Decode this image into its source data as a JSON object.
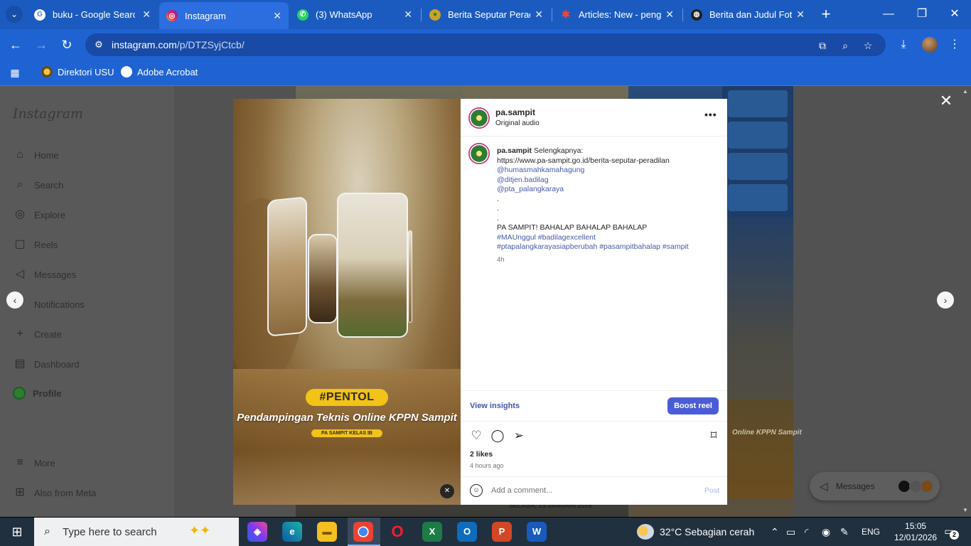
{
  "browser": {
    "tabs": [
      {
        "title": "buku - Google Search",
        "favicon": "google-icon",
        "active": false
      },
      {
        "title": "Instagram",
        "favicon": "instagram-icon",
        "active": true
      },
      {
        "title": "(3) WhatsApp",
        "favicon": "whatsapp-icon",
        "active": false
      },
      {
        "title": "Berita Seputar Peradilan",
        "favicon": "pa-logo-icon",
        "active": false
      },
      {
        "title": "Articles: New - pengadilan",
        "favicon": "joomla-icon",
        "active": false
      },
      {
        "title": "Berita dan Judul Foto",
        "favicon": "web-icon",
        "active": false
      }
    ],
    "url_host": "instagram.com",
    "url_path": "/p/DTZSyjCtcb/",
    "bookmarks": [
      {
        "label": "Direktori USU"
      },
      {
        "label": "Adobe Acrobat"
      }
    ]
  },
  "sidebar": {
    "logo": "Instagram",
    "items": [
      {
        "label": "Home",
        "icon": "home-icon"
      },
      {
        "label": "Search",
        "icon": "search-icon"
      },
      {
        "label": "Explore",
        "icon": "compass-icon"
      },
      {
        "label": "Reels",
        "icon": "reels-icon"
      },
      {
        "label": "Messages",
        "icon": "messenger-icon"
      },
      {
        "label": "Notifications",
        "icon": "heart-icon"
      },
      {
        "label": "Create",
        "icon": "plus-icon"
      },
      {
        "label": "Dashboard",
        "icon": "dashboard-icon"
      },
      {
        "label": "Profile",
        "icon": "avatar"
      },
      {
        "label": "More",
        "icon": "menu-icon"
      },
      {
        "label": "Also from Meta",
        "icon": "meta-icon"
      }
    ]
  },
  "background": {
    "right_caption": "Online KPPN Sampit",
    "bottom_caption": "SELASA, 13 JANUARI 2026"
  },
  "post": {
    "username": "pa.sampit",
    "audio": "Original audio",
    "media": {
      "badge": "#PENTOL",
      "subtitle": "Pendampingan Teknis Online KPPN Sampit",
      "tag": "PA SAMPIT KELAS IB"
    },
    "caption": {
      "user": "pa.sampit",
      "lines": [
        "Selengkapnya:",
        "https://www.pa-sampit.go.id/berita-seputar-peradilan",
        "@humasmahkamahagung",
        "@ditjen.badilag",
        "@pta_palangkaraya",
        ".",
        ".",
        ".",
        "PA SAMPIT! BAHALAP BAHALAP BAHALAP",
        "#MAUnggul #badilagexcellent",
        "#ptapalangkarayasiapberubah #pasampitbahalap #sampit"
      ],
      "time": "4h"
    },
    "view_insights": "View insights",
    "boost_label": "Boost reel",
    "likes": "2 likes",
    "ago": "4 hours ago",
    "comment_placeholder": "Add a comment...",
    "post_label": "Post"
  },
  "messages_pill": {
    "label": "Messages"
  },
  "taskbar": {
    "search_placeholder": "Type here to search",
    "weather": "32°C  Sebagian cerah",
    "lang": "ENG",
    "time": "15:05",
    "date": "12/01/2026",
    "notifications": "2"
  }
}
